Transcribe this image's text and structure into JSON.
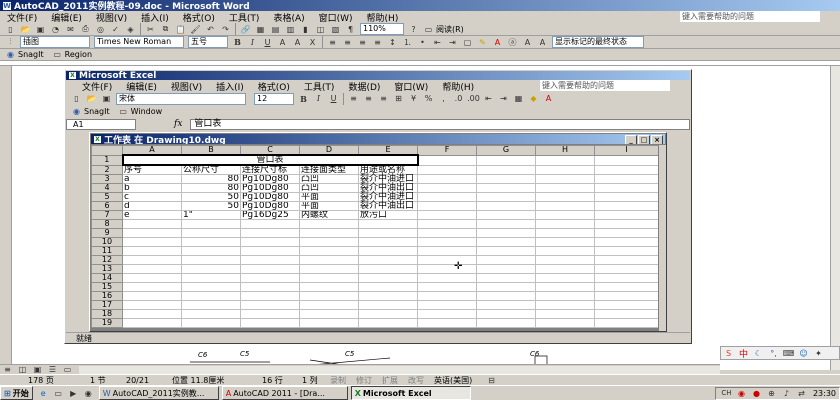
{
  "word": {
    "title": "AutoCAD_2011实例教程-09.doc - Microsoft Word",
    "menus": [
      "文件(F)",
      "编辑(E)",
      "视图(V)",
      "插入(I)",
      "格式(O)",
      "工具(T)",
      "表格(A)",
      "窗口(W)",
      "帮助(H)"
    ],
    "help_placeholder": "键入需要帮助的问题",
    "zoom": "110%",
    "reading": "阅读(R)",
    "insert_label": "插图",
    "font": "Times New Roman",
    "size": "五号",
    "show_markup": "显示标记的最终状态",
    "snagit": "SnagIt",
    "region": "Region"
  },
  "excel": {
    "title": "Microsoft Excel",
    "menus": [
      "文件(F)",
      "编辑(E)",
      "视图(V)",
      "插入(I)",
      "格式(O)",
      "工具(T)",
      "数据(D)",
      "窗口(W)",
      "帮助(H)"
    ],
    "help_placeholder": "键入需要帮助的问题",
    "font": "宋体",
    "size": "12",
    "snagit": "SnagIt",
    "window": "Window",
    "cell_ref": "A1",
    "fx": "fx",
    "formula": "管口表",
    "workbook_title": "工作表 在 Drawing10.dwg",
    "status": "就绪",
    "columns": [
      "A",
      "B",
      "C",
      "D",
      "E",
      "F",
      "G",
      "H",
      "I"
    ],
    "rows": [
      [
        "管口表"
      ],
      [
        "序号",
        "公称尺寸",
        "连接尺寸标",
        "连接面类型",
        "用途或名称"
      ],
      [
        "a",
        "80",
        "Pg10Dg80",
        "凸凹",
        "裂介中油进口"
      ],
      [
        "b",
        "80",
        "Pg10Dg80",
        "凸凹",
        "裂介中油出口"
      ],
      [
        "c",
        "50",
        "Pg10Dg80",
        "平面",
        "裂介中油进口"
      ],
      [
        "d",
        "50",
        "Pg10Dg80",
        "平面",
        "裂介中油出口"
      ],
      [
        "e",
        "1\"",
        "Pg16Dg25",
        "内螺纹",
        "放污口"
      ]
    ],
    "row_numbers": [
      "1",
      "2",
      "3",
      "4",
      "5",
      "6",
      "7",
      "8",
      "9",
      "10",
      "11",
      "12",
      "13",
      "14",
      "15",
      "16",
      "17",
      "18",
      "19"
    ]
  },
  "word_status": {
    "page": "178 页",
    "section": "1 节",
    "pages": "20/21",
    "position": "位置 11.8厘米",
    "line": "16 行",
    "col": "1 列",
    "rec": "录制",
    "trk": "修订",
    "ext": "扩展",
    "ovr": "改写",
    "lang": "英语(美国)"
  },
  "drawing_labels": [
    "C6",
    "C5",
    "C5",
    "C6"
  ],
  "taskbar": {
    "start": "开始",
    "tasks": [
      "AutoCAD_2011实例教...",
      "AutoCAD 2011 - [Dra...",
      "Microsoft Excel"
    ],
    "time": "23:30",
    "ime": "中"
  }
}
